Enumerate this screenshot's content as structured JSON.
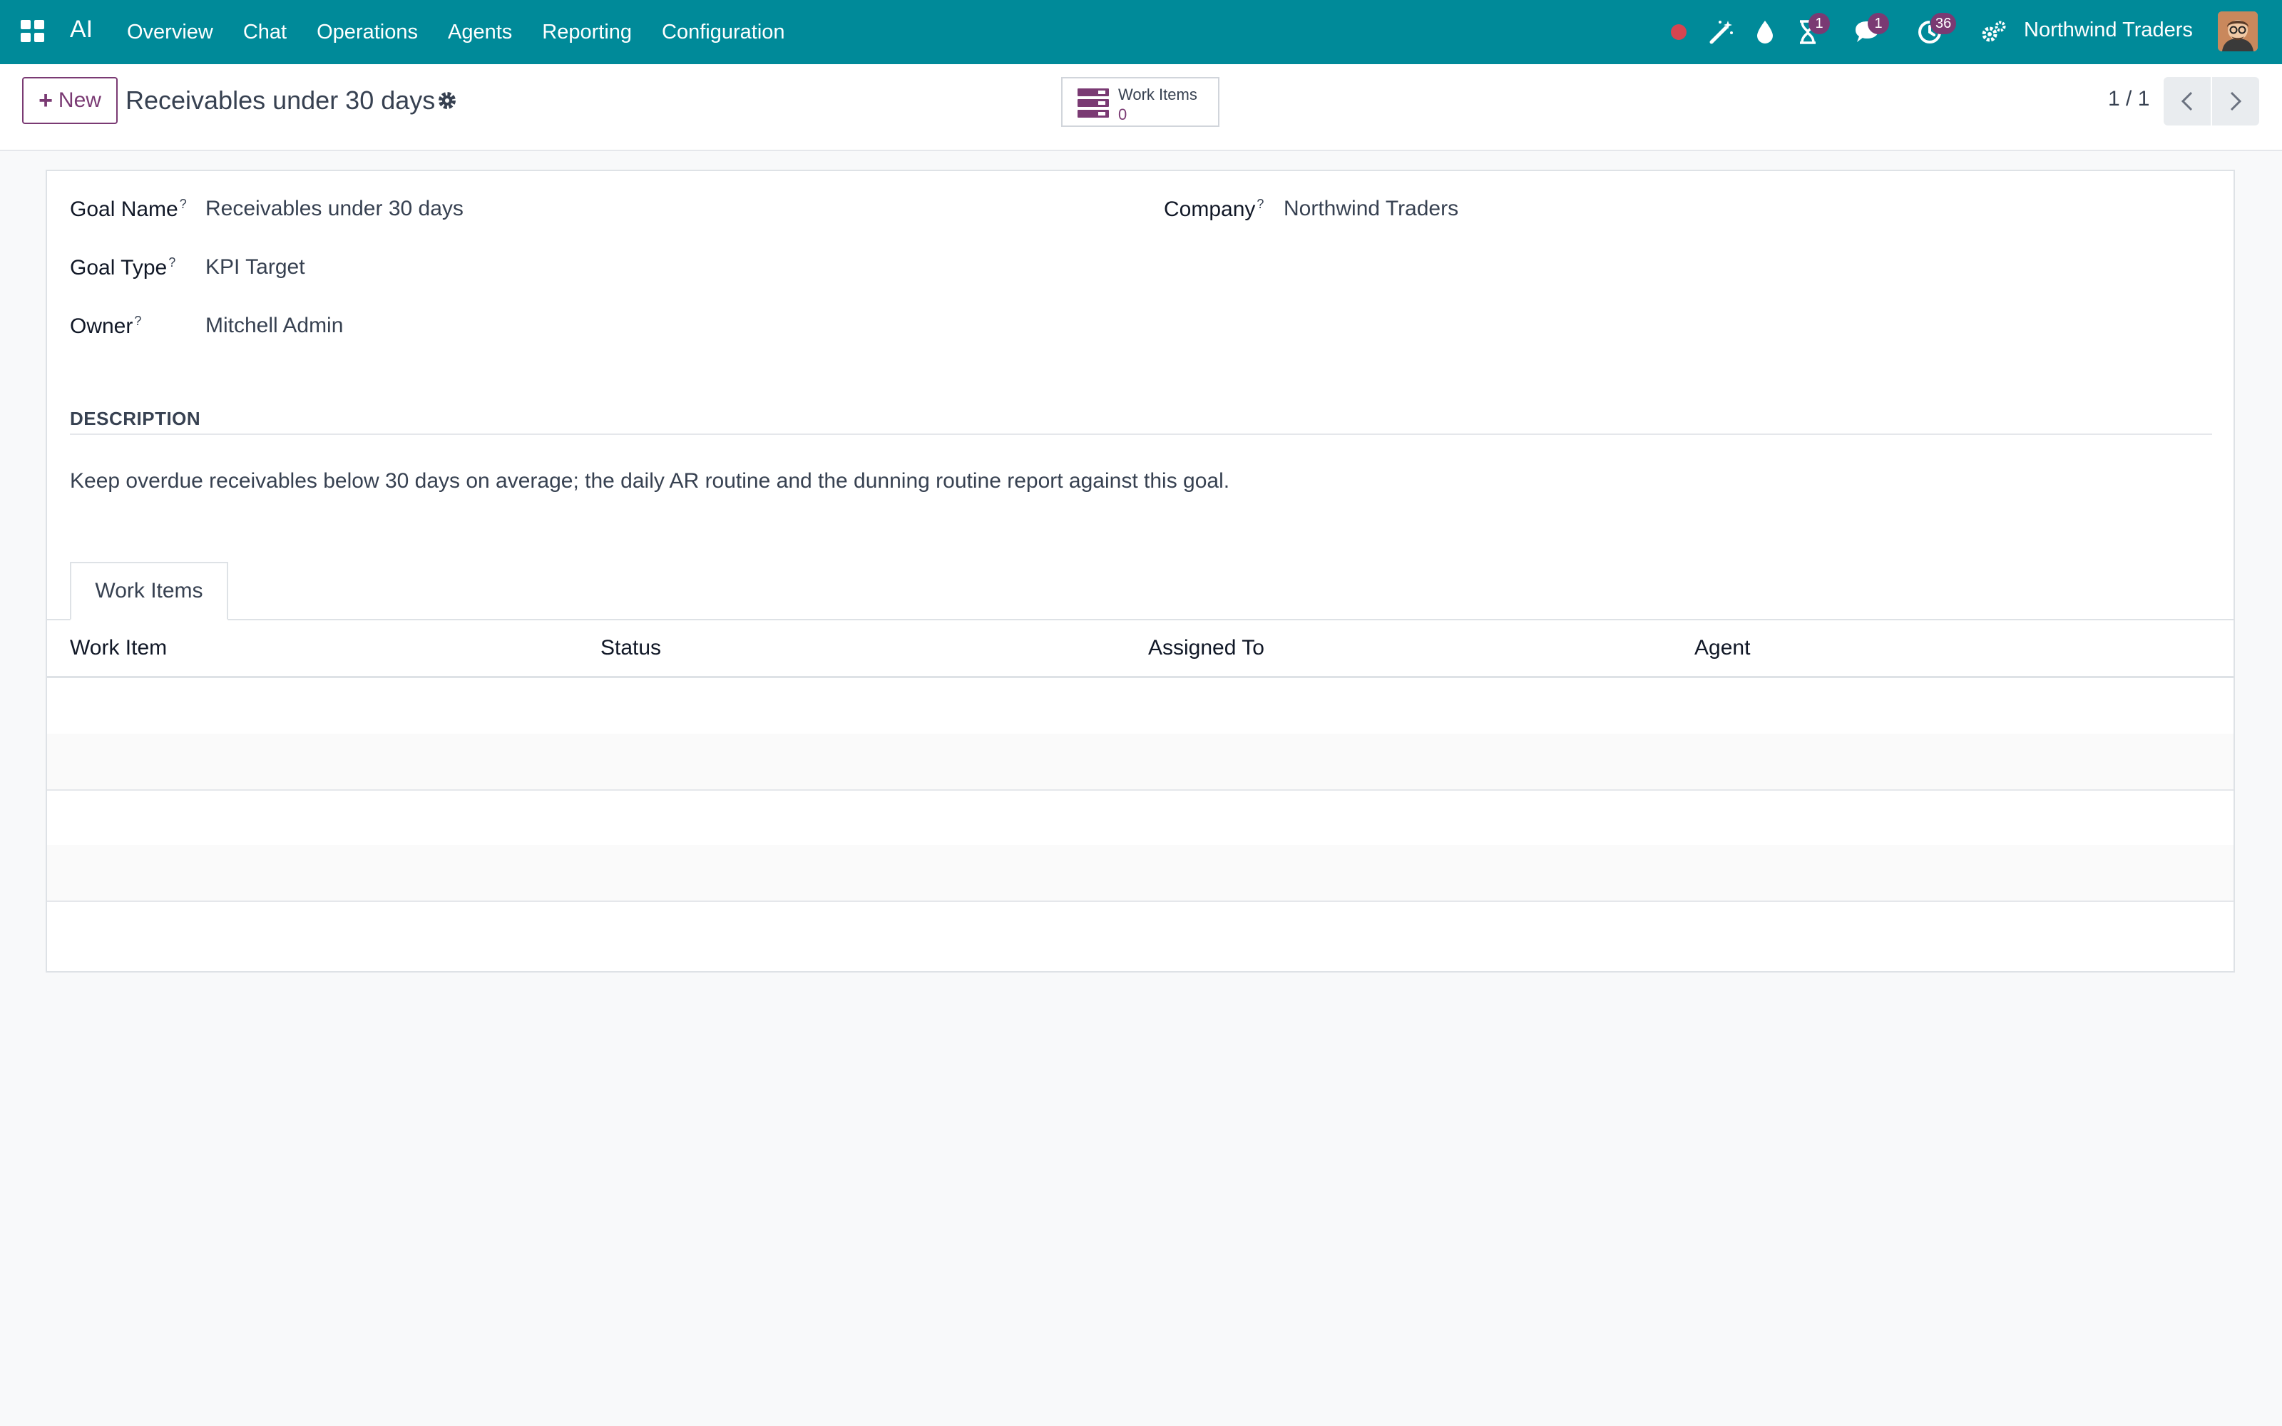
{
  "navbar": {
    "app_name": "AI",
    "menu": [
      "Overview",
      "Chat",
      "Operations",
      "Agents",
      "Reporting",
      "Configuration"
    ],
    "badges": {
      "activity": "1",
      "messages": "1",
      "timer": "36"
    },
    "company": "Northwind Traders",
    "accent": "#008a99"
  },
  "control": {
    "new_label": "New",
    "title": "Receivables under 30 days",
    "smart_button": {
      "label": "Work Items",
      "value": "0"
    },
    "pager": "1 / 1"
  },
  "form": {
    "goal_name_label": "Goal Name",
    "goal_name": "Receivables under 30 days",
    "goal_type_label": "Goal Type",
    "goal_type": "KPI Target",
    "owner_label": "Owner",
    "owner": "Mitchell Admin",
    "company_label": "Company",
    "company": "Northwind Traders",
    "help_mark": "?",
    "description_title": "DESCRIPTION",
    "description": "Keep overdue receivables below 30 days on average; the daily AR routine and the dunning routine report against this goal."
  },
  "tabs": [
    "Work Items"
  ],
  "table": {
    "columns": [
      "Work Item",
      "Status",
      "Assigned To",
      "Agent"
    ],
    "rows": []
  },
  "colors": {
    "primary": "#7a3a73",
    "badge": "#7a3a73",
    "record_dot": "#dc3545"
  }
}
